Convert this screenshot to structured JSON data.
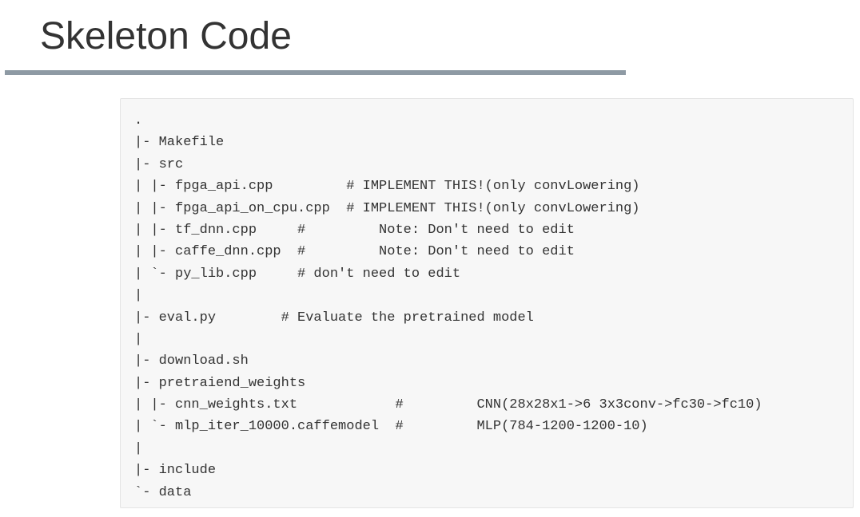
{
  "slide": {
    "title": "Skeleton Code"
  },
  "code": {
    "lines": [
      ".",
      "|- Makefile",
      "|- src",
      "| |- fpga_api.cpp         # IMPLEMENT THIS!(only convLowering)",
      "| |- fpga_api_on_cpu.cpp  # IMPLEMENT THIS!(only convLowering)",
      "| |- tf_dnn.cpp     #         Note: Don't need to edit",
      "| |- caffe_dnn.cpp  #         Note: Don't need to edit",
      "| `- py_lib.cpp     # don't need to edit",
      "|",
      "|- eval.py        # Evaluate the pretrained model",
      "|",
      "|- download.sh",
      "|- pretraiend_weights",
      "| |- cnn_weights.txt            #         CNN(28x28x1->6 3x3conv->fc30->fc10)",
      "| `- mlp_iter_10000.caffemodel  #         MLP(784-1200-1200-10)",
      "|",
      "|- include",
      "`- data"
    ]
  }
}
